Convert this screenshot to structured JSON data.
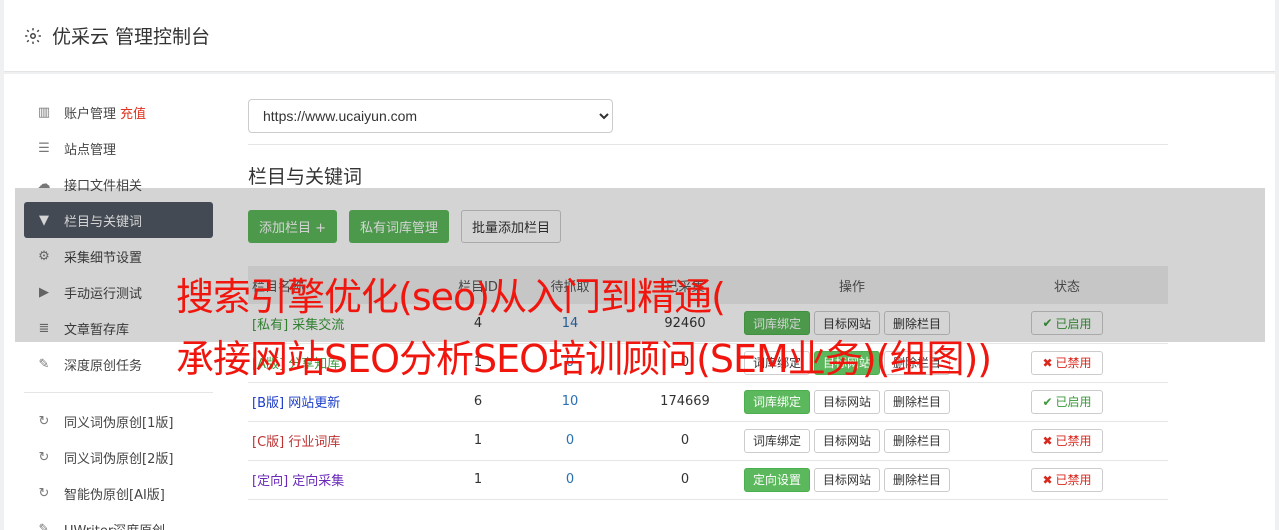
{
  "header": {
    "title": "优采云 管理控制台",
    "icon": "gear-icon"
  },
  "sidebar": {
    "items": [
      {
        "label": "账户管理",
        "extra": "充值",
        "icon": "bar-chart-icon"
      },
      {
        "label": "站点管理",
        "icon": "server-icon"
      },
      {
        "label": "接口文件相关",
        "icon": "cloud-upload-icon"
      },
      {
        "label": "栏目与关键词",
        "icon": "filter-icon",
        "active": true
      },
      {
        "label": "采集细节设置",
        "icon": "cogs-icon"
      },
      {
        "label": "手动运行测试",
        "icon": "play-icon"
      },
      {
        "label": "文章暂存库",
        "icon": "database-icon"
      },
      {
        "label": "深度原创任务",
        "icon": "edit-icon"
      }
    ],
    "items2": [
      {
        "label": "同义词伪原创[1版]",
        "icon": "refresh-icon"
      },
      {
        "label": "同义词伪原创[2版]",
        "icon": "refresh-icon"
      },
      {
        "label": "智能伪原创[AI版]",
        "icon": "refresh-icon"
      },
      {
        "label": "UWriter深度原创",
        "icon": "edit-icon"
      }
    ]
  },
  "main": {
    "site_select": "https://www.ucaiyun.com",
    "section_title": "栏目与关键词",
    "buttons": {
      "add": "添加栏目 +",
      "private": "私有词库管理",
      "batch": "批量添加栏目"
    },
    "table": {
      "headers": [
        "栏目名称",
        "栏目ID",
        "待抓取",
        "已采集",
        "操作",
        "状态"
      ],
      "rows": [
        {
          "tag": "[私有]",
          "name": "采集交流",
          "id": "4",
          "pending": "14",
          "collected": "92460",
          "op1": "词库绑定",
          "op1_green": true,
          "op2": "目标网站",
          "op2_green": false,
          "op3": "删除栏目",
          "status": "已启用",
          "on": true,
          "color": "green"
        },
        {
          "tag": "[A版]",
          "name": "分享知库",
          "id": "1",
          "pending": "0",
          "collected": "0",
          "op1": "词库绑定",
          "op1_green": false,
          "op2": "目标网站",
          "op2_green": true,
          "op3": "删除栏目",
          "status": "已禁用",
          "on": false,
          "color": "green"
        },
        {
          "tag": "[B版]",
          "name": "网站更新",
          "id": "6",
          "pending": "10",
          "collected": "174669",
          "op1": "词库绑定",
          "op1_green": true,
          "op2": "目标网站",
          "op2_green": false,
          "op3": "删除栏目",
          "status": "已启用",
          "on": true,
          "color": "blue"
        },
        {
          "tag": "[C版]",
          "name": "行业词库",
          "id": "1",
          "pending": "0",
          "collected": "0",
          "op1": "词库绑定",
          "op1_green": false,
          "op2": "目标网站",
          "op2_green": false,
          "op3": "删除栏目",
          "status": "已禁用",
          "on": false,
          "color": "red"
        },
        {
          "tag": "[定向]",
          "name": "定向采集",
          "id": "1",
          "pending": "0",
          "collected": "0",
          "op1": "定向设置",
          "op1_green": true,
          "op2": "目标网站",
          "op2_green": false,
          "op3": "删除栏目",
          "status": "已禁用",
          "on": false,
          "color": "purple"
        }
      ]
    }
  },
  "watermark": {
    "line1": "搜索引擎优化(seo)从入门到精通(",
    "line2": "承接网站SEO分析SEO培训顾问(SEM业务)(组图))"
  }
}
